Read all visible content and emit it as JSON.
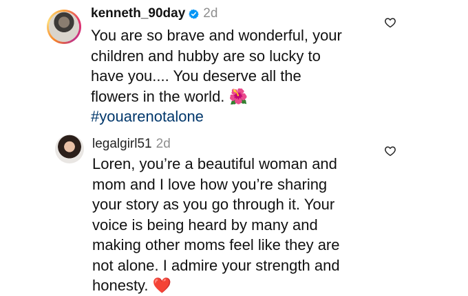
{
  "comments": [
    {
      "username": "kenneth_90day",
      "verified": true,
      "time": "2d",
      "text": "You are so brave and wonderful, your\nchildren and hubby are so lucky to\nhave you.... You deserve all the\nflowers in the world. ",
      "emoji": "🌺",
      "hashtag": "#youarenotalone",
      "like_icon": "heart-outline-icon"
    },
    {
      "username": "legalgirl51",
      "verified": false,
      "time": "2d",
      "text": "Loren, you’re a beautiful woman and\nmom and I love how you’re sharing\nyour story as you go through it. Your\nvoice is being heard by many and\nmaking other moms feel like they are\nnot alone. I admire your strength and\nhonesty. ",
      "emoji": "❤️",
      "like_icon": "heart-outline-icon"
    }
  ],
  "colors": {
    "verified_badge": "#0095f6",
    "hashtag": "#00376b",
    "timestamp": "#8e8e8e"
  }
}
